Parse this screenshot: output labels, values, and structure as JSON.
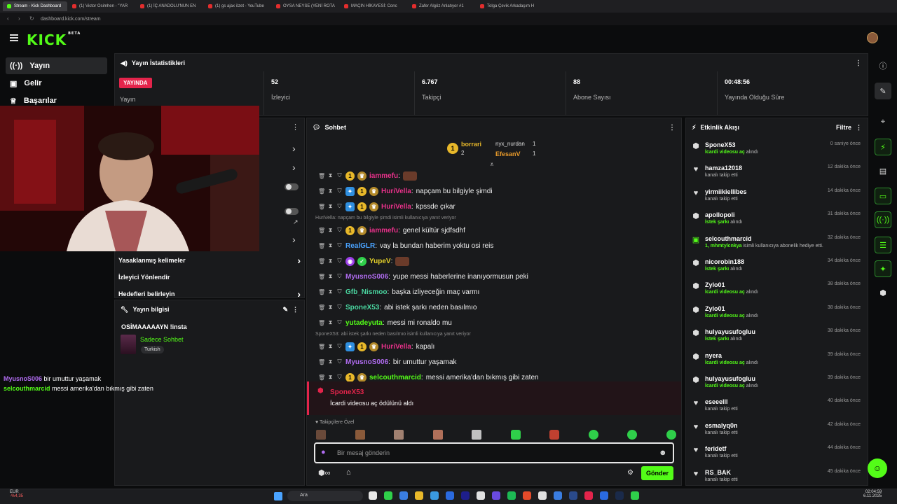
{
  "browser": {
    "tabs": [
      {
        "label": "Stream - Kick Dashboard",
        "active": true,
        "kick": true
      },
      {
        "label": "(1) Victor Osimhen - \"YAR",
        "active": false
      },
      {
        "label": "(1) İÇ ANADOLU'NUN EN",
        "active": false
      },
      {
        "label": "(1) gs ajax özet - YouTube",
        "active": false
      },
      {
        "label": "OYSA NEYSE (YENİ ROTA",
        "active": false
      },
      {
        "label": "MAÇIN HİKAYESİ: Conc",
        "active": false
      },
      {
        "label": "Zafer Algöz Anlatıyor #1",
        "active": false
      },
      {
        "label": "Tolga Çevik Arkadaşım H",
        "active": false
      }
    ],
    "address": "dashboard.kick.com/stream"
  },
  "header": {
    "logo": "KICK",
    "beta": "BETA"
  },
  "sidebar": {
    "items": [
      {
        "label": "Yayın",
        "icon": "broadcast-icon"
      },
      {
        "label": "Gelir",
        "icon": "revenue-icon"
      },
      {
        "label": "Başarılar",
        "icon": "trophy-icon"
      }
    ]
  },
  "stats": {
    "title": "Yayın İstatistikleri",
    "live_badge": "YAYINDA",
    "live_label": "Yayın",
    "items": [
      {
        "value": "52",
        "label": "İzleyici"
      },
      {
        "value": "6.767",
        "label": "Takipçi"
      },
      {
        "value": "88",
        "label": "Abone Sayısı"
      },
      {
        "value": "00:48:56",
        "label": "Yayında Olduğu Süre"
      }
    ]
  },
  "left_panel": {
    "rows": [
      {
        "label": "Yasaklanmış kelimeler"
      },
      {
        "label": "İzleyici Yönlendir"
      },
      {
        "label": "Hedefleri belirleyin"
      }
    ]
  },
  "stream_info": {
    "title": "Yayın bilgisi",
    "stream_title": "OSİMAAAAAYN !insta",
    "category": "Sadece Sohbet",
    "tag": "Turkish"
  },
  "overlay_chat": [
    {
      "user": "MyusnoS006",
      "color": "#b06cf0",
      "text": "bir umuttur yaşamak"
    },
    {
      "user": "selcouthmarcid",
      "color": "#53fc18",
      "text": "messi amerika'dan bıkmış gibi zaten"
    }
  ],
  "chat": {
    "title": "Sohbet",
    "top_gifters": [
      {
        "name": "borrari",
        "count": "2"
      },
      {
        "name": "nyx_nurdan",
        "count": "1"
      },
      {
        "name": "EfesanV",
        "count": "1"
      }
    ],
    "messages": [
      {
        "user": "iammefu",
        "color": "#e8318a",
        "text": "",
        "badges": [
          "gold",
          "sub"
        ],
        "emote": true
      },
      {
        "user": "HuriVella",
        "color": "#e8318a",
        "text": "napçam bu bilgiyle şimdi",
        "badges": [
          "blue",
          "gold",
          "sub"
        ]
      },
      {
        "user": "HuriVella",
        "color": "#e8318a",
        "text": "kpssde çıkar",
        "badges": [
          "blue",
          "gold",
          "sub"
        ]
      },
      {
        "user": "iammefu",
        "color": "#e8318a",
        "text": "genel kültür sjdfsdhf",
        "badges": [
          "gold",
          "sub"
        ],
        "reply": "HuriVella: napçam bu bilgiyle şimdi isimli kullanıcıya yanıt veriyor"
      },
      {
        "user": "RealGLR",
        "color": "#4aa3ff",
        "text": "vay la bundan haberim yoktu osi reis",
        "badges": []
      },
      {
        "user": "YupeV",
        "color": "#e8d42a",
        "text": "",
        "badges": [
          "purple",
          "green"
        ],
        "emote": true
      },
      {
        "user": "MyusnoS006",
        "color": "#b06cf0",
        "text": "yupe messi haberlerine inanıyormusun peki",
        "badges": []
      },
      {
        "user": "Gfb_Nismoo",
        "color": "#4ad6a0",
        "text": "başka izliyeceğin maç varmı",
        "badges": []
      },
      {
        "user": "SponeX53",
        "color": "#4ad6a0",
        "text": "abi istek şarkı neden basılmıo",
        "badges": []
      },
      {
        "user": "yutadeyuta",
        "color": "#53fc18",
        "text": "messi mi ronaldo mu",
        "badges": []
      },
      {
        "user": "HuriVella",
        "color": "#e8318a",
        "text": "kapalı",
        "badges": [
          "blue",
          "gold",
          "sub"
        ],
        "reply": "SponeX53: abi istek şarkı neden basılmıo isimli kullanıcıya yanıt veriyor"
      },
      {
        "user": "MyusnoS006",
        "color": "#b06cf0",
        "text": "bir umuttur yaşamak",
        "badges": []
      },
      {
        "user": "selcouthmarcid",
        "color": "#53fc18",
        "text": "messi amerika'dan bıkmış gibi zaten",
        "badges": [
          "gold",
          "sub"
        ]
      }
    ],
    "reward": {
      "user": "SponeX53",
      "text": "İcardi videosu aç ödülünü aldı"
    },
    "emote_section": "Takipçilere Özel",
    "input_placeholder": "Bir mesaj gönderin",
    "send_label": "Gönder"
  },
  "activity": {
    "title": "Etkinlik Akışı",
    "filter_label": "Filtre",
    "events": [
      {
        "name": "SponeX53",
        "action": "İcardi videosu aç",
        "suffix": " alındı",
        "time": "0 saniye önce",
        "icon": "reward-icon"
      },
      {
        "name": "hamza12018",
        "action": "",
        "suffix": "kanalı takip etti",
        "time": "12 dakika önce",
        "icon": "heart-icon"
      },
      {
        "name": "yirmiikiellibes",
        "action": "",
        "suffix": "kanalı takip etti",
        "time": "14 dakika önce",
        "icon": "heart-icon"
      },
      {
        "name": "apollopoli",
        "action": "İstek şarkı",
        "suffix": " alındı",
        "time": "31 dakika önce",
        "icon": "reward-icon"
      },
      {
        "name": "selcouthmarcid",
        "action": "1, mhmtylcnkya",
        "suffix": " isimli kullanıcıya abonelik hediye etti.",
        "time": "32 dakika önce",
        "icon": "gift-icon"
      },
      {
        "name": "nicorobin188",
        "action": "İstek şarkı",
        "suffix": " alındı",
        "time": "34 dakika önce",
        "icon": "reward-icon"
      },
      {
        "name": "Zylo01",
        "action": "İcardi videosu aç",
        "suffix": " alındı",
        "time": "38 dakika önce",
        "icon": "reward-icon"
      },
      {
        "name": "Zylo01",
        "action": "İcardi videosu aç",
        "suffix": " alındı",
        "time": "38 dakika önce",
        "icon": "reward-icon"
      },
      {
        "name": "hulyayusufogluu",
        "action": "İstek şarkı",
        "suffix": " alındı",
        "time": "38 dakika önce",
        "icon": "reward-icon"
      },
      {
        "name": "nyera",
        "action": "İcardi videosu aç",
        "suffix": " alındı",
        "time": "39 dakika önce",
        "icon": "reward-icon"
      },
      {
        "name": "hulyayusufogluu",
        "action": "İcardi videosu aç",
        "suffix": " alındı",
        "time": "39 dakika önce",
        "icon": "reward-icon"
      },
      {
        "name": "eseeelll",
        "action": "",
        "suffix": "kanalı takip etti",
        "time": "40 dakika önce",
        "icon": "heart-icon"
      },
      {
        "name": "esmalyq0n",
        "action": "",
        "suffix": "kanalı takip etti",
        "time": "42 dakika önce",
        "icon": "heart-icon"
      },
      {
        "name": "feridetf",
        "action": "",
        "suffix": "kanalı takip etti",
        "time": "44 dakika önce",
        "icon": "heart-icon"
      },
      {
        "name": "RS_BAK",
        "action": "",
        "suffix": "kanalı takip etti",
        "time": "45 dakika önce",
        "icon": "heart-icon"
      }
    ]
  },
  "taskbar": {
    "currency": "EUR",
    "change": "-%4,35",
    "search": "Ara",
    "time": "02:04:59",
    "date": "6.11.2025"
  },
  "colors": {
    "accent": "#53fc18",
    "live": "#e3244b",
    "panel": "#191a1c"
  }
}
